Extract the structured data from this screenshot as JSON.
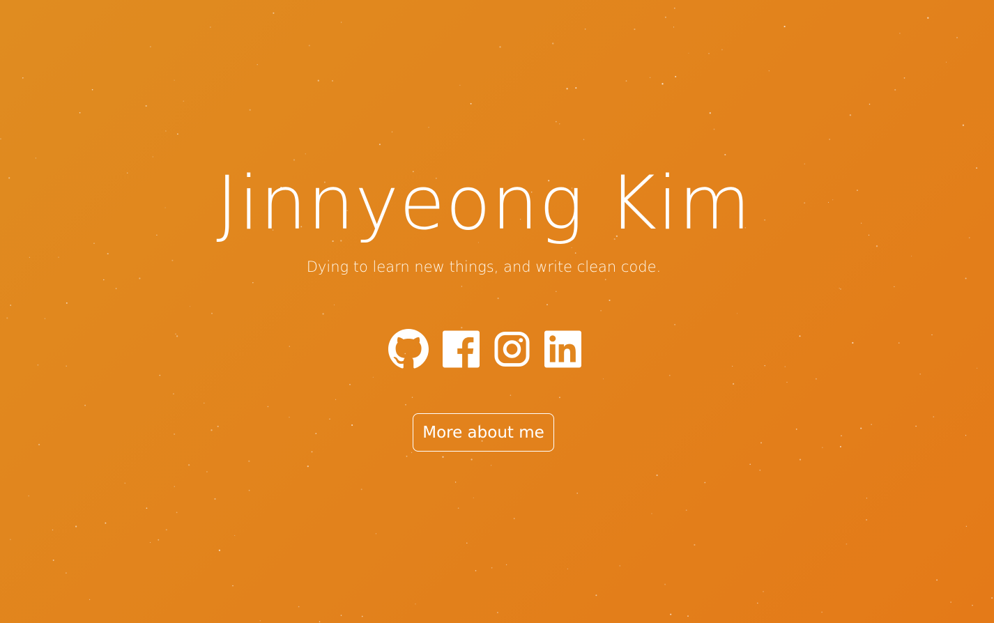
{
  "hero": {
    "name": "Jinnyeong Kim",
    "tagline": "Dying to learn new things, and write clean code.",
    "more_button_label": "More about me"
  },
  "social_links": [
    {
      "name": "github",
      "icon": "github-icon"
    },
    {
      "name": "facebook",
      "icon": "facebook-icon"
    },
    {
      "name": "instagram",
      "icon": "instagram-icon"
    },
    {
      "name": "linkedin",
      "icon": "linkedin-icon"
    }
  ],
  "colors": {
    "background_start": "#e08c20",
    "background_end": "#e47a18",
    "foreground": "#ffffff"
  }
}
